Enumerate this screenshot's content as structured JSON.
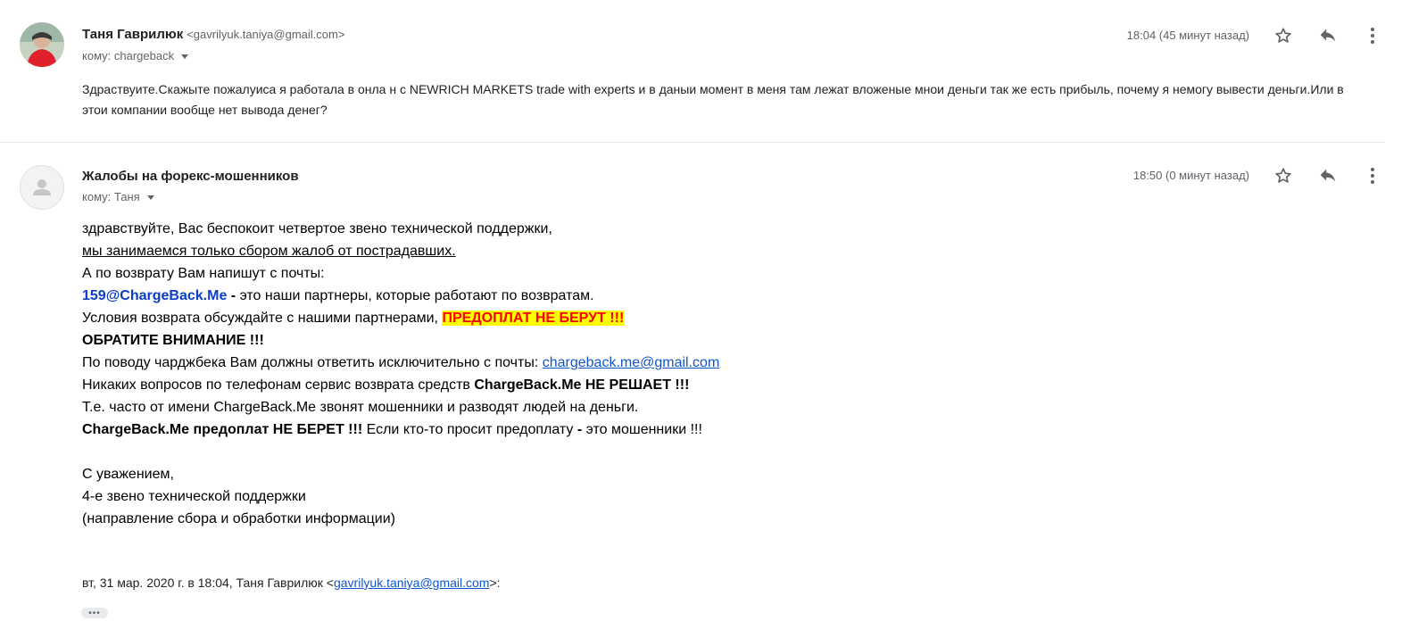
{
  "messages": [
    {
      "sender_name": "Таня Гаврилюк",
      "sender_email": "<gavrilyuk.taniya@gmail.com>",
      "recipient": "кому: chargeback",
      "timestamp": "18:04 (45 минут назад)",
      "avatar_icon": "user-photo",
      "body": "Здраствуите.Скажыте пожалуиса я работала в онла н с NEWRICH MARKETS trade with experts и в даныи момент в меня там лежат вложеные мнои  деньги так же есть прибыль, почему я немогу вывести деньги.Или в этои компании вообще нет вывода денег?"
    },
    {
      "sender_name": "Жалобы на форекс-мошенников",
      "recipient": "кому: Таня",
      "timestamp": "18:50 (0 минут назад)",
      "avatar_icon": "default-person-icon",
      "body": {
        "line1": "здравствуйте, Вас беспокоит четвертое звено технической поддержки,",
        "line2": "мы занимаемся только сбором жалоб от пострадавших.",
        "line3": "А по возврату Вам напишут с почты:",
        "line4_email": "159@ChargeBack.Me",
        "line4_dash": " - ",
        "line4_rest": "это наши партнеры, которые работают по возвратам.",
        "line5_text": "Условия возврата обсуждайте с нашими партнерами, ",
        "line5_highlight": "ПРЕДОПЛАТ НЕ БЕРУТ !!!",
        "line6": "ОБРАТИТЕ ВНИМАНИЕ !!!",
        "line7_text": "По поводу чарджбека Вам должны ответить исключительно с почты: ",
        "line7_link": "chargeback.me@gmail.com",
        "line8_text": "Никаких вопросов по телефонам сервис возврата средств ",
        "line8_bold": "ChargeBack.Me НЕ РЕШАЕТ !!!",
        "line9": "Т.е. часто от имени ChargeBack.Me звонят мошенники и разводят людей на деньги.",
        "line10_bold": "ChargeBack.Me предоплат НЕ БЕРЕТ !!!",
        "line10_text1": " Если кто-то просит предоплату ",
        "line10_dash": "-",
        "line10_text2": " это мошенники !!!",
        "sign1": "С уважением,",
        "sign2": "4-е звено технической поддержки",
        "sign3": "(направление сбора и обработки информации)"
      },
      "quote_prefix": "вт, 31 мар. 2020 г. в 18:04, Таня Гаврилюк <",
      "quote_link": "gavrilyuk.taniya@gmail.com",
      "quote_suffix": ">:",
      "trimmed_content_label": "•••"
    }
  ],
  "icons": {
    "star": "star-outline-icon",
    "reply": "reply-arrow-icon",
    "more": "vertical-dots-icon"
  },
  "colors": {
    "highlight_bg": "#ffff00",
    "highlight_text": "#ff0000",
    "link": "#1155cc",
    "email_blue": "#0b3dc9"
  }
}
